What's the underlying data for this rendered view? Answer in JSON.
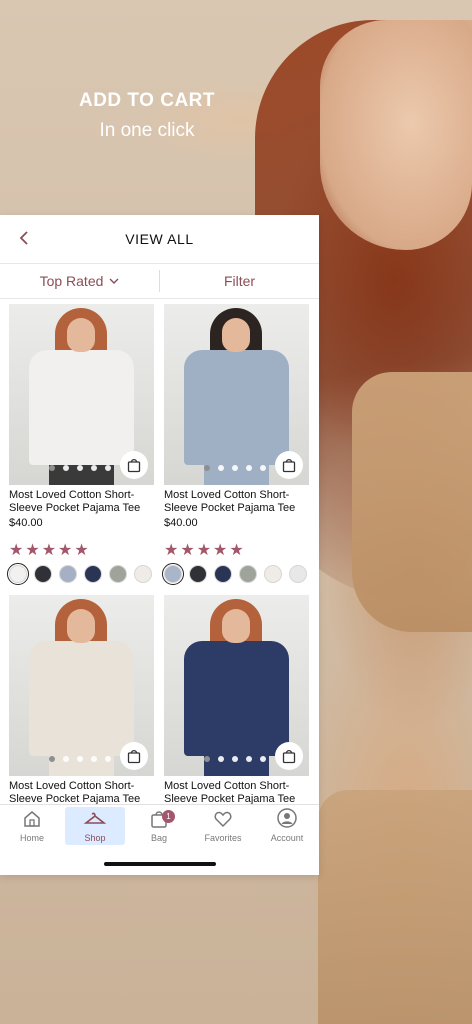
{
  "promo": {
    "headline": "ADD TO CART",
    "subline": "In one click"
  },
  "header": {
    "title": "VIEW ALL"
  },
  "sortbar": {
    "sort_label": "Top Rated",
    "filter_label": "Filter"
  },
  "products": [
    {
      "name": "Most Loved Cotton Short-Sleeve Pocket Pajama Tee",
      "price": "$40.00",
      "rating": 5,
      "shirt_color": "#f1f0ee",
      "hair_color": "#b4623b",
      "leg_color": "#3a3a3a",
      "swatches": [
        "#f2f1ef",
        "#2f3136",
        "#a5b0c4",
        "#2a3556",
        "#9ea49a",
        "#efece7"
      ],
      "selected": 0,
      "image_dots": 5,
      "active_dot": 0
    },
    {
      "name": "Most Loved Cotton Short-Sleeve Pocket Pajama Tee",
      "price": "$40.00",
      "rating": 5,
      "shirt_color": "#9fafc4",
      "hair_color": "#2c2420",
      "leg_color": "#9fafc4",
      "swatches": [
        "#a9b5c8",
        "#2f3136",
        "#2a3556",
        "#9ea49a",
        "#efece7",
        "#e8e8e8"
      ],
      "selected": 0,
      "image_dots": 5,
      "active_dot": 0
    },
    {
      "name": "Most Loved Cotton Short-Sleeve Pocket Pajama Tee",
      "price": "",
      "rating": 0,
      "shirt_color": "#e9e2d8",
      "hair_color": "#b4623b",
      "leg_color": "#e9e2d8",
      "swatches": [],
      "selected": -1,
      "image_dots": 5,
      "active_dot": 0
    },
    {
      "name": "Most Loved Cotton Short-Sleeve Pocket Pajama Tee",
      "price": "",
      "rating": 0,
      "shirt_color": "#2c3c66",
      "hair_color": "#b4623b",
      "leg_color": "#2c3c66",
      "swatches": [],
      "selected": -1,
      "image_dots": 5,
      "active_dot": 0
    }
  ],
  "tabs": [
    {
      "label": "Home",
      "icon": "home-icon"
    },
    {
      "label": "Shop",
      "icon": "hanger-icon",
      "active": true
    },
    {
      "label": "Bag",
      "icon": "bag-icon",
      "badge": "1"
    },
    {
      "label": "Favorites",
      "icon": "heart-icon"
    },
    {
      "label": "Account",
      "icon": "account-icon"
    }
  ],
  "colors": {
    "accent": "#8b4d58",
    "star": "#a3576a",
    "active_tab_bg": "#dcebff"
  }
}
